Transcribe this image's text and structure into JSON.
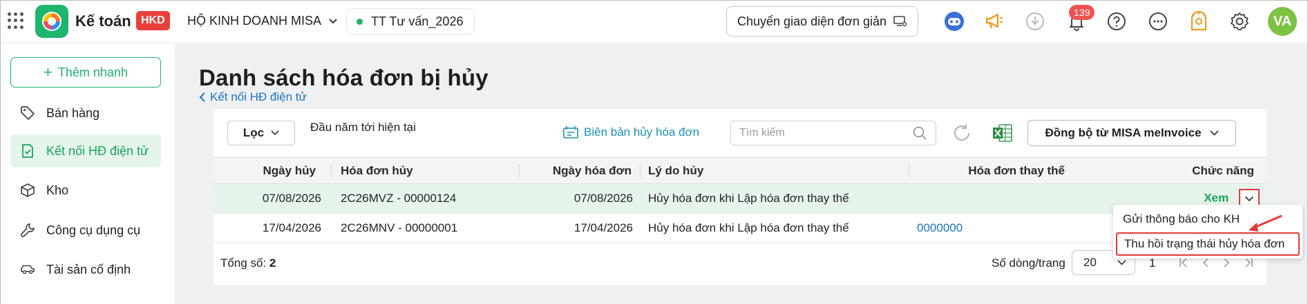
{
  "topbar": {
    "app_name": "Kế toán",
    "badge": "HKD",
    "company": "HỘ KINH DOANH MISA",
    "period": "TT Tư vấn_2026",
    "switch_ui_label": "Chuyển giao diện đơn giản",
    "notification_count": "139",
    "avatar_initials": "VA"
  },
  "sidebar": {
    "quick_add": "Thêm nhanh",
    "items": [
      {
        "label": "Bán hàng",
        "icon": "tag-icon"
      },
      {
        "label": "Kết nối HĐ điện tử",
        "icon": "invoice-check-icon"
      },
      {
        "label": "Kho",
        "icon": "box-icon"
      },
      {
        "label": "Công cụ dụng cụ",
        "icon": "wrench-icon"
      },
      {
        "label": "Tài sản cố định",
        "icon": "car-icon"
      }
    ]
  },
  "main": {
    "title": "Danh sách hóa đơn bị hủy",
    "back_link": "Kết nối HĐ điện tử",
    "toolbar": {
      "filter": "Lọc",
      "date_range": "Đầu năm tới hiện tại",
      "cancel_report": "Biên bản hủy hóa đơn",
      "search_placeholder": "Tìm kiếm",
      "sync": "Đồng bộ từ MISA meInvoice"
    },
    "table": {
      "headers": [
        "Ngày hủy",
        "Hóa đơn hủy",
        "Ngày hóa đơn",
        "Lý do hủy",
        "Hóa đơn thay thế",
        "Chức năng"
      ],
      "rows": [
        {
          "cancel_date": "07/08/2026",
          "invoice": "2C26MVZ - 00000124",
          "invoice_date": "07/08/2026",
          "reason": "Hủy hóa đơn khi Lập hóa đơn thay thế",
          "replacement": "",
          "action": "Xem"
        },
        {
          "cancel_date": "17/04/2026",
          "invoice": "2C26MNV - 00000001",
          "invoice_date": "17/04/2026",
          "reason": "Hủy hóa đơn khi Lập hóa đơn thay thế",
          "replacement": "0000000",
          "action": ""
        }
      ]
    },
    "footer": {
      "total_label": "Tổng số:",
      "total_value": "2",
      "rows_per_page_label": "Số dòng/trang",
      "rows_per_page": "20",
      "page": "1"
    },
    "menu": {
      "items": [
        "Gửi thông báo cho KH",
        "Thu hồi trạng thái hủy hóa đơn"
      ]
    }
  },
  "colors": {
    "accent": "#1fb56e",
    "link": "#1b74c4",
    "highlight": "#e53935"
  }
}
